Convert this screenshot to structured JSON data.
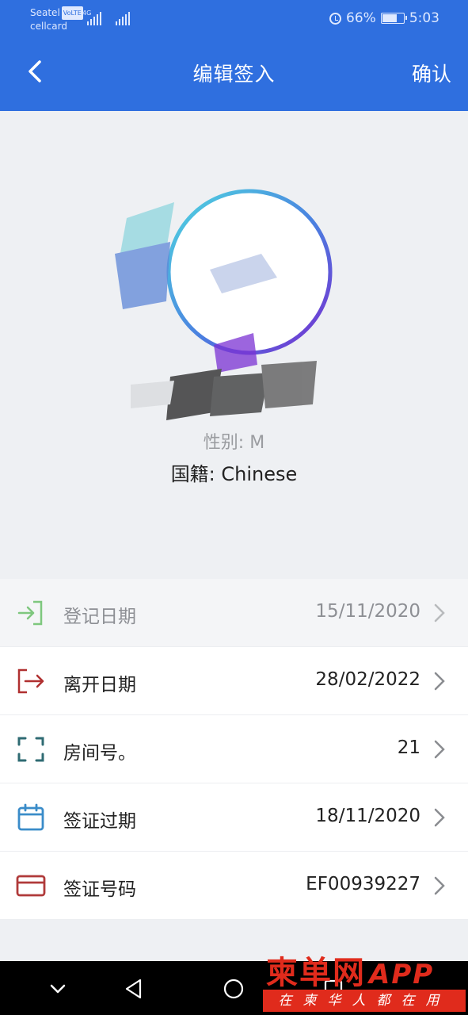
{
  "status_bar": {
    "carrier_1": "Seatel",
    "volte": "VoLTE",
    "network": "4G",
    "carrier_2": "cellcard",
    "battery_percent": "66%",
    "battery_level": 0.66,
    "time": "5:03"
  },
  "header": {
    "title": "编辑签入",
    "confirm_label": "确认"
  },
  "profile": {
    "gender_text": "性别: M",
    "nationality_text": "国籍: Chinese"
  },
  "rows": [
    {
      "label": "登记日期",
      "value": "15/11/2020",
      "icon": "checkin-arrow-icon",
      "enabled": false
    },
    {
      "label": "离开日期",
      "value": "28/02/2022",
      "icon": "checkout-arrow-icon",
      "enabled": true
    },
    {
      "label": "房间号。",
      "value": "21",
      "icon": "room-frame-icon",
      "enabled": true
    },
    {
      "label": "签证过期",
      "value": "18/11/2020",
      "icon": "calendar-icon",
      "enabled": true
    },
    {
      "label": "签证号码",
      "value": "EF00939227",
      "icon": "card-icon",
      "enabled": true
    }
  ],
  "watermark": {
    "brand": "柬单网",
    "app": "APP",
    "slogan": "在柬华人都在用"
  },
  "colors": {
    "header_bg": "#2f6fdf",
    "checkin_green": "#7ec77e",
    "checkout_red": "#b03030",
    "room_teal": "#2f6b73",
    "calendar_blue": "#3a8cc9",
    "card_red": "#b03a3a",
    "watermark_red": "#e02b1c"
  }
}
